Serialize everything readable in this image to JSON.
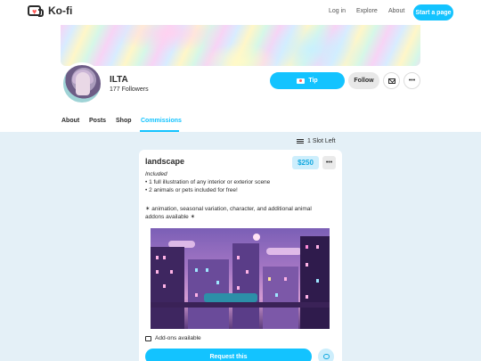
{
  "header": {
    "logo_text": "Ko-fi",
    "nav": [
      "Log in",
      "Explore",
      "About"
    ],
    "cta": "Start a page"
  },
  "profile": {
    "name": "ILTA",
    "followers": "177 Followers",
    "tip_label": "Tip",
    "follow_label": "Follow",
    "more_label": "•••"
  },
  "tabs": [
    "About",
    "Posts",
    "Shop",
    "Commissions"
  ],
  "active_tab": "Commissions",
  "commissions": {
    "slots": "1 Slot Left",
    "card": {
      "title": "landscape",
      "price": "$250",
      "more_label": "•••",
      "included_heading": "Included",
      "included_items": [
        "• 1 full illustration of any interior or exterior scene",
        "• 2 animals or pets included for free!"
      ],
      "note_line1": "✶ animation, seasonal variation, character, and additional animal",
      "note_line2": "addons available ✶",
      "addons_label": "Add-ons available",
      "request_label": "Request this"
    }
  },
  "colors": {
    "accent": "#13c3ff",
    "content_bg": "#e4f0f7",
    "price_bg": "#cdeefc"
  }
}
